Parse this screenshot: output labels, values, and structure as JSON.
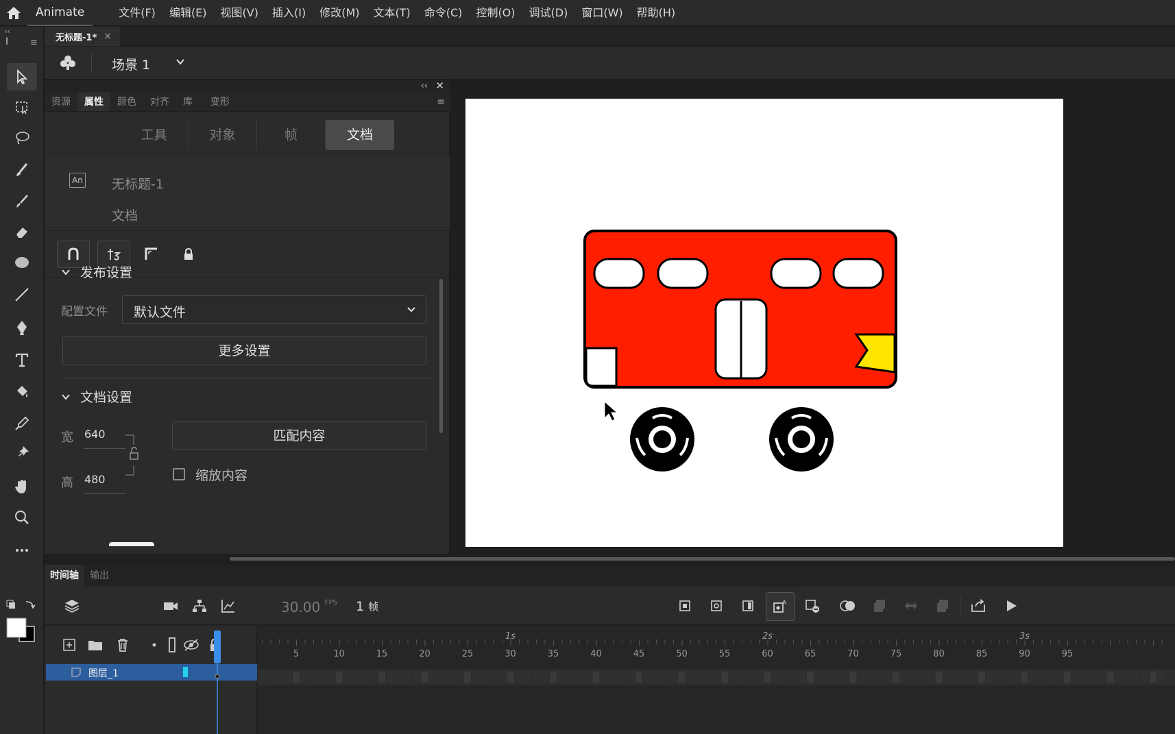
{
  "app": {
    "name": "Animate",
    "menu": [
      "文件(F)",
      "编辑(E)",
      "视图(V)",
      "插入(I)",
      "修改(M)",
      "文本(T)",
      "命令(C)",
      "控制(O)",
      "调试(D)",
      "窗口(W)",
      "帮助(H)"
    ]
  },
  "document": {
    "tab_title": "无标题-1*",
    "scene_label": "场景 1"
  },
  "panel": {
    "tabs": [
      "资源",
      "属性",
      "颜色",
      "对齐",
      "库",
      "变形"
    ],
    "active_tab": "属性",
    "subtabs": [
      "工具",
      "对象",
      "帧",
      "文档"
    ],
    "active_subtab": "文档",
    "badge": "An",
    "doc_name": "无标题-1",
    "doc_type": "文档",
    "publish": {
      "title": "发布设置",
      "profile_label": "配置文件",
      "profile_value": "默认文件",
      "more_settings": "更多设置"
    },
    "doc_settings": {
      "title": "文档设置",
      "width_label": "宽",
      "width_value": "640",
      "height_label": "高",
      "height_value": "480",
      "match_content": "匹配内容",
      "scale_content": "缩放内容"
    }
  },
  "timeline": {
    "tabs": [
      "时间轴",
      "输出"
    ],
    "fps_value": "30.00",
    "fps_unit": "FPS",
    "frame_value": "1",
    "frame_unit": "帧",
    "layer_name": "图层_1",
    "layer_color": "#22d3f0",
    "ticks": [
      "5",
      "10",
      "15",
      "20",
      "25",
      "30",
      "35",
      "40",
      "45",
      "50",
      "55",
      "60",
      "65",
      "70",
      "75",
      "80",
      "85",
      "90",
      "95"
    ],
    "seconds": [
      "1s",
      "2s",
      "3s"
    ]
  },
  "colors": {
    "bus_body": "#ff1f00",
    "bus_flame": "#ffe600",
    "selection": "#2c5e9e"
  }
}
